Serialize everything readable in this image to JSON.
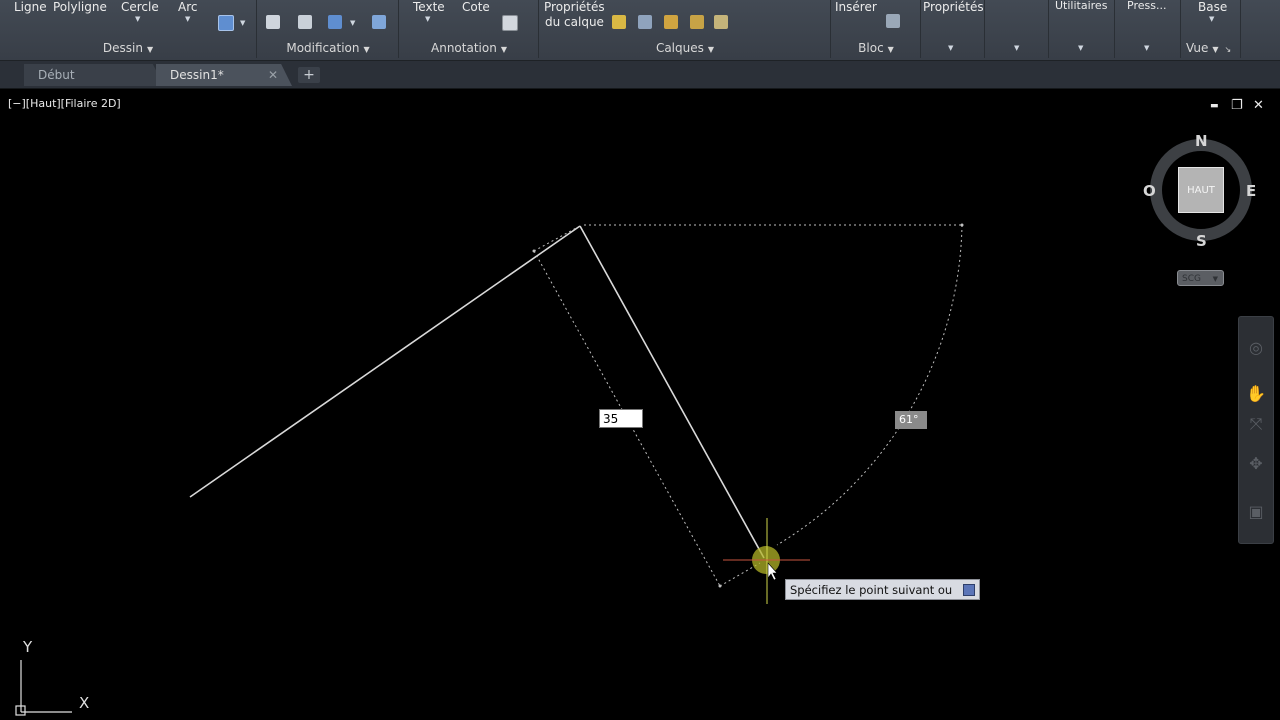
{
  "ribbon": {
    "draw": {
      "title": "Dessin",
      "line": "Ligne",
      "polyline": "Polyligne",
      "circle": "Cercle",
      "arc": "Arc"
    },
    "modify": {
      "title": "Modification"
    },
    "annotation": {
      "title": "Annotation",
      "text": "Texte",
      "dimension": "Cote"
    },
    "layers": {
      "title": "Calques",
      "properties_line1": "Propriétés",
      "properties_line2": "du calque"
    },
    "block": {
      "title": "Bloc",
      "insert": "Insérer"
    },
    "properties": {
      "label": "Propriétés"
    },
    "utilities": {
      "label": "Utilitaires"
    },
    "clipboard": {
      "label": "Press..."
    },
    "view": {
      "label": "Base",
      "title": "Vue"
    }
  },
  "tabs": [
    {
      "label": "Début",
      "active": false
    },
    {
      "label": "Dessin1*",
      "active": true
    }
  ],
  "newtab_symbol": "+",
  "viewport": {
    "label": "[−][Haut][Filaire 2D]",
    "minimize": "▬",
    "restore": "❐",
    "close": "✕"
  },
  "drawing": {
    "dynamic_input_value": "35",
    "angle_value": "61°",
    "command_prompt": "Spécifiez le point suivant ou"
  },
  "viewcube": {
    "north": "N",
    "south": "S",
    "east": "E",
    "west": "O",
    "face": "HAUT",
    "wcs": "SCG"
  },
  "ucs": {
    "y": "Y",
    "x": "X"
  },
  "colors": {
    "background": "#000000",
    "line": "#d9d9d9",
    "crosshair_vertical": "#d0d64a",
    "crosshair_horizontal": "#c8563f",
    "osnap_marker": "#b3b427"
  }
}
